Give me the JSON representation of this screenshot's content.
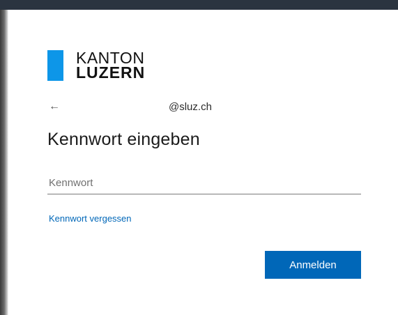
{
  "logo": {
    "line1": "KANTON",
    "line2": "LUZERN",
    "accent_color": "#0d96e8"
  },
  "identity": {
    "back_icon": "arrow-left-icon",
    "back_glyph": "←",
    "email": "@sluz.ch"
  },
  "title": "Kennwort eingeben",
  "password": {
    "placeholder": "Kennwort",
    "value": ""
  },
  "forgot_link": "Kennwort vergessen",
  "signin_button": "Anmelden",
  "colors": {
    "primary": "#0067b8",
    "link": "#0067b8"
  }
}
